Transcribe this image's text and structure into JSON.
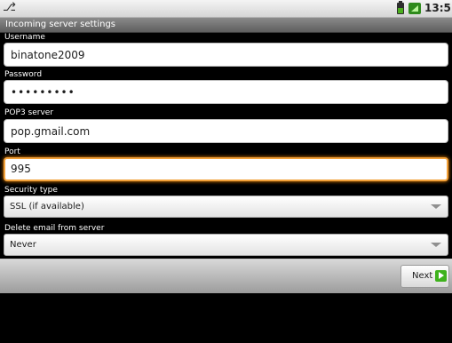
{
  "status_bar": {
    "notification_icon": "usb-icon",
    "battery_icon": "battery-icon",
    "signal_icon": "signal-icon",
    "time": "13:5"
  },
  "header": {
    "title": "Incoming server settings"
  },
  "form": {
    "username_label": "Username",
    "username_value": "binatone2009",
    "password_label": "Password",
    "password_value": "•••••••••",
    "server_label": "POP3 server",
    "server_value": "pop.gmail.com",
    "port_label": "Port",
    "port_value": "995",
    "security_label": "Security type",
    "security_value": "SSL (if available)",
    "delete_label": "Delete email from server",
    "delete_value": "Never"
  },
  "footer": {
    "next_label": "Next",
    "next_icon": "arrow-right-icon"
  },
  "colors": {
    "focus_border": "#f2a13a",
    "next_icon_green": "#3eb21c",
    "title_bar": "#6f6f6f"
  }
}
